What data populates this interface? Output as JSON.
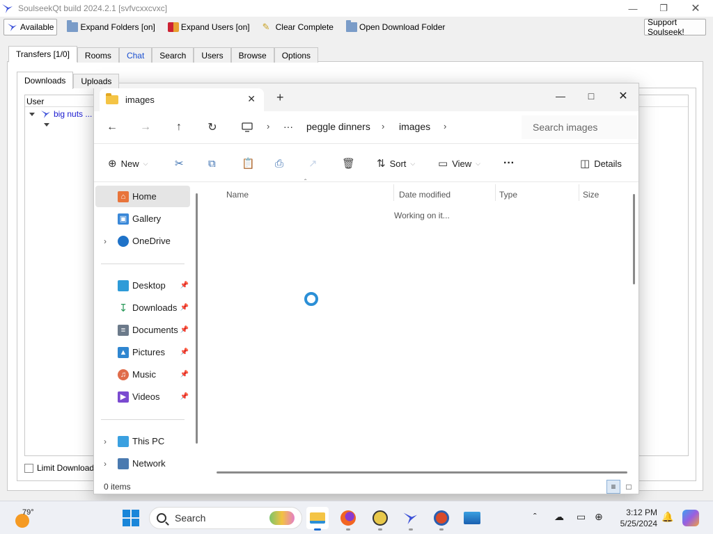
{
  "soulseek": {
    "title": "SoulseekQt build 2024.2.1 [svfvcxxcvxc]",
    "toolbar": {
      "available": "Available",
      "expand_folders": "Expand Folders [on]",
      "expand_users": "Expand Users [on]",
      "clear_complete": "Clear Complete",
      "open_download_folder": "Open Download Folder",
      "support": "Support Soulseek!"
    },
    "tabs": [
      "Transfers [1/0]",
      "Rooms",
      "Chat",
      "Search",
      "Users",
      "Browse",
      "Options"
    ],
    "subtabs": [
      "Downloads",
      "Uploads"
    ],
    "tree_header": "User",
    "tree_user": "big nuts ...",
    "limit_label": "Limit Download S"
  },
  "explorer": {
    "tab_title": "images",
    "breadcrumb": [
      "peggle dinners",
      "images"
    ],
    "more_crumbs": "···",
    "search_placeholder": "Search images",
    "commands": {
      "new": "New",
      "sort": "Sort",
      "view": "View",
      "more": "···",
      "details": "Details"
    },
    "nav": {
      "home": "Home",
      "gallery": "Gallery",
      "onedrive": "OneDrive",
      "desktop": "Desktop",
      "downloads": "Downloads",
      "documents": "Documents",
      "pictures": "Pictures",
      "music": "Music",
      "videos": "Videos",
      "this_pc": "This PC",
      "network": "Network"
    },
    "columns": [
      "Name",
      "Date modified",
      "Type",
      "Size"
    ],
    "status_text": "Working on it...",
    "item_count": "0 items"
  },
  "taskbar": {
    "temperature": "79°",
    "search_label": "Search",
    "time": "3:12 PM",
    "date": "5/25/2024"
  },
  "colors": {
    "accent": "#1a6cd2",
    "folder": "#f4c445",
    "spinner": "#2b8fd6"
  }
}
